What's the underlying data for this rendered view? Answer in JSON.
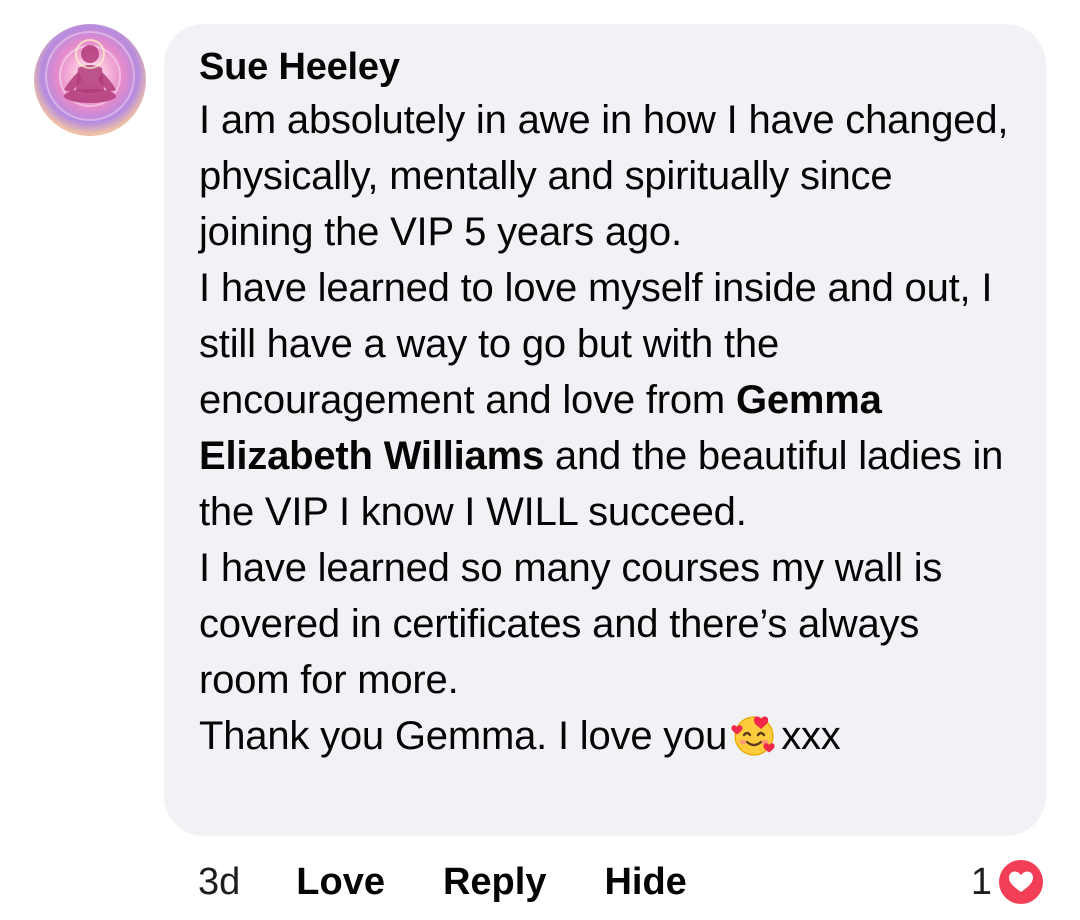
{
  "comment": {
    "author": "Sue Heeley",
    "paragraphs": {
      "p1": "I am absolutely in awe in how I have changed, physically, mentally and spiritually since joining the VIP 5 years ago.",
      "p2_before": "I have learned to love myself inside and out, I still have a way to go but with the encouragement and love from ",
      "p2_mention": "Gemma Elizabeth Williams",
      "p2_after": " and the beautiful ladies in the VIP I know I WILL succeed.",
      "p3": "I have learned so many courses my wall is covered in certificates and there’s always room for more.",
      "p4_before": "Thank you Gemma. I love you",
      "p4_emoji": "smiling-face-with-hearts-emoji",
      "p4_after": "xxx"
    }
  },
  "actions": {
    "time": "3d",
    "love": "Love",
    "reply": "Reply",
    "hide": "Hide"
  },
  "reactions": {
    "count": "1",
    "icon": "heart-icon",
    "color": "#f33e58"
  },
  "colors": {
    "bubble": "#f0f2f5",
    "text": "#050505"
  }
}
